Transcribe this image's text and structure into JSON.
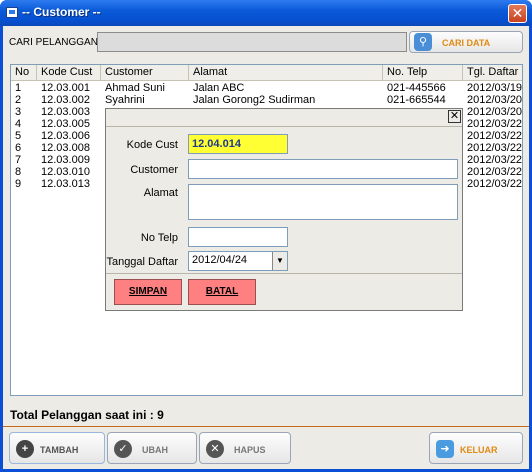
{
  "window": {
    "title": "-- Customer --"
  },
  "search": {
    "label": "CARI PELANGGAN",
    "value": "",
    "button_label": "CARI DATA"
  },
  "table": {
    "columns": [
      "No",
      "Kode Cust",
      "Customer",
      "Alamat",
      "No. Telp",
      "Tgl. Daftar"
    ],
    "rows": [
      [
        "1",
        "12.03.001",
        "Ahmad Suni",
        "Jalan ABC",
        "021-445566",
        "2012/03/19"
      ],
      [
        "2",
        "12.03.002",
        "Syahrini",
        "Jalan Gorong2 Sudirman",
        "021-665544",
        "2012/03/20"
      ],
      [
        "3",
        "12.03.003",
        "",
        "",
        "",
        "2012/03/20"
      ],
      [
        "4",
        "12.03.005",
        "",
        "",
        "",
        "2012/03/22"
      ],
      [
        "5",
        "12.03.006",
        "",
        "",
        "",
        "2012/03/22"
      ],
      [
        "6",
        "12.03.008",
        "",
        "",
        "",
        "2012/03/22"
      ],
      [
        "7",
        "12.03.009",
        "",
        "",
        "",
        "2012/03/22"
      ],
      [
        "8",
        "12.03.010",
        "",
        "",
        "",
        "2012/03/22"
      ],
      [
        "9",
        "12.03.013",
        "",
        "",
        "",
        "2012/03/22"
      ]
    ]
  },
  "footer": {
    "total_text": "Total Pelanggan saat ini : 9"
  },
  "buttons": {
    "tambah": "TAMBAH",
    "ubah": "UBAH",
    "hapus": "HAPUS",
    "keluar": "KELUAR"
  },
  "dialog": {
    "kode_label": "Kode Cust",
    "kode_value": "12.04.014",
    "customer_label": "Customer",
    "customer_value": "",
    "alamat_label": "Alamat",
    "alamat_value": "",
    "telp_label": "No Telp",
    "telp_value": "",
    "tanggal_label": "Tanggal Daftar",
    "tanggal_value": "2012/04/24",
    "simpan": "SIMPAN",
    "batal": "BATAL"
  },
  "icons": {
    "title": "window-icon",
    "close": "close-icon",
    "search": "magnifier-icon",
    "tambah": "plus-circle-icon",
    "ubah": "check-circle-icon",
    "hapus": "x-circle-icon",
    "keluar": "arrow-right-icon"
  },
  "colors": {
    "titlebar": "#0a5ad8",
    "accent_orange": "#e08a10",
    "highlight": "#ffff33",
    "dialog_button": "#ff8080"
  }
}
